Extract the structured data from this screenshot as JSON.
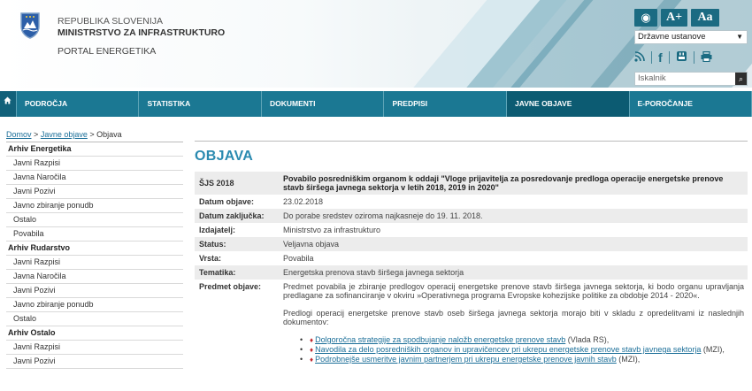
{
  "header": {
    "line1": "REPUBLIKA SLOVENIJA",
    "line2": "MINISTRSTVO ZA INFRASTRUKTURO",
    "line3": "PORTAL ENERGETIKA",
    "tools": {
      "contrast": "◉",
      "increase": "A+",
      "font": "Aa"
    },
    "institutions_select": "Državne ustanove",
    "search_placeholder": "Iskalnik",
    "accent": "#1b6b82"
  },
  "nav": {
    "home_icon": "home-icon",
    "items": [
      "PODROČJA",
      "STATISTIKA",
      "DOKUMENTI",
      "PREDPISI",
      "JAVNE OBJAVE",
      "E-POROČANJE"
    ],
    "active": "JAVNE OBJAVE",
    "bar_color": "#1b7893"
  },
  "breadcrumb": {
    "home": "Domov",
    "sep": ">",
    "section": "Javne objave",
    "current": "Objava"
  },
  "sidebar": {
    "groups": [
      {
        "title": "Arhiv Energetika",
        "items": [
          "Javni Razpisi",
          "Javna Naročila",
          "Javni Pozivi",
          "Javno zbiranje ponudb",
          "Ostalo",
          "Povabila"
        ]
      },
      {
        "title": "Arhiv Rudarstvo",
        "items": [
          "Javni Razpisi",
          "Javna Naročila",
          "Javni Pozivi",
          "Javno zbiranje ponudb",
          "Ostalo"
        ]
      },
      {
        "title": "Arhiv Ostalo",
        "items": [
          "Javni Razpisi",
          "Javni Pozivi"
        ]
      }
    ]
  },
  "main": {
    "title": "OBJAVA",
    "rows": [
      {
        "label": "ŠJS 2018",
        "value": "Povabilo posredniškim organom k oddaji \"Vloge prijavitelja za posredovanje predloga operacije energetske prenove stavb širšega javnega sektorja v letih 2018, 2019 in 2020\""
      },
      {
        "label": "Datum objave:",
        "value": "23.02.2018"
      },
      {
        "label": "Datum zaključka:",
        "value": "Do porabe sredstev oziroma najkasneje do 19. 11. 2018."
      },
      {
        "label": "Izdajatelj:",
        "value": "Ministrstvo za infrastrukturo"
      },
      {
        "label": "Status:",
        "value": "Veljavna objava"
      },
      {
        "label": "Vrsta:",
        "value": "Povabila"
      },
      {
        "label": "Tematika:",
        "value": "Energetska prenova stavb širšega javnega sektorja"
      }
    ],
    "subject_label": "Predmet objave:",
    "subject_p1": "Predmet povabila je zbiranje predlogov operacij energetske prenove stavb širšega javnega sektorja, ki bodo organu upravljanja predlagane za sofinanciranje v okviru »Operativnega programa Evropske kohezijske politike za obdobje 2014 - 2020«.",
    "subject_p2": "Predlogi operacij energetske prenove stavb oseb širšega javnega sektorja morajo biti v skladu z opredelitvami iz naslednjih dokumentov:",
    "documents": [
      {
        "link": "Dolgoročna strategije za spodbujanje naložb energetske prenove stavb",
        "suffix": " (Vlada RS),"
      },
      {
        "link": "Navodila za delo posredniških organov in upravičencev pri ukrepu energetske prenove stavb javnega sektorja",
        "suffix": " (MZI),"
      },
      {
        "link": "Podrobnejše usmeritve javnim partnerjem pri ukrepu energetske prenove javnih stavb",
        "suffix": " (MZI),"
      }
    ]
  }
}
